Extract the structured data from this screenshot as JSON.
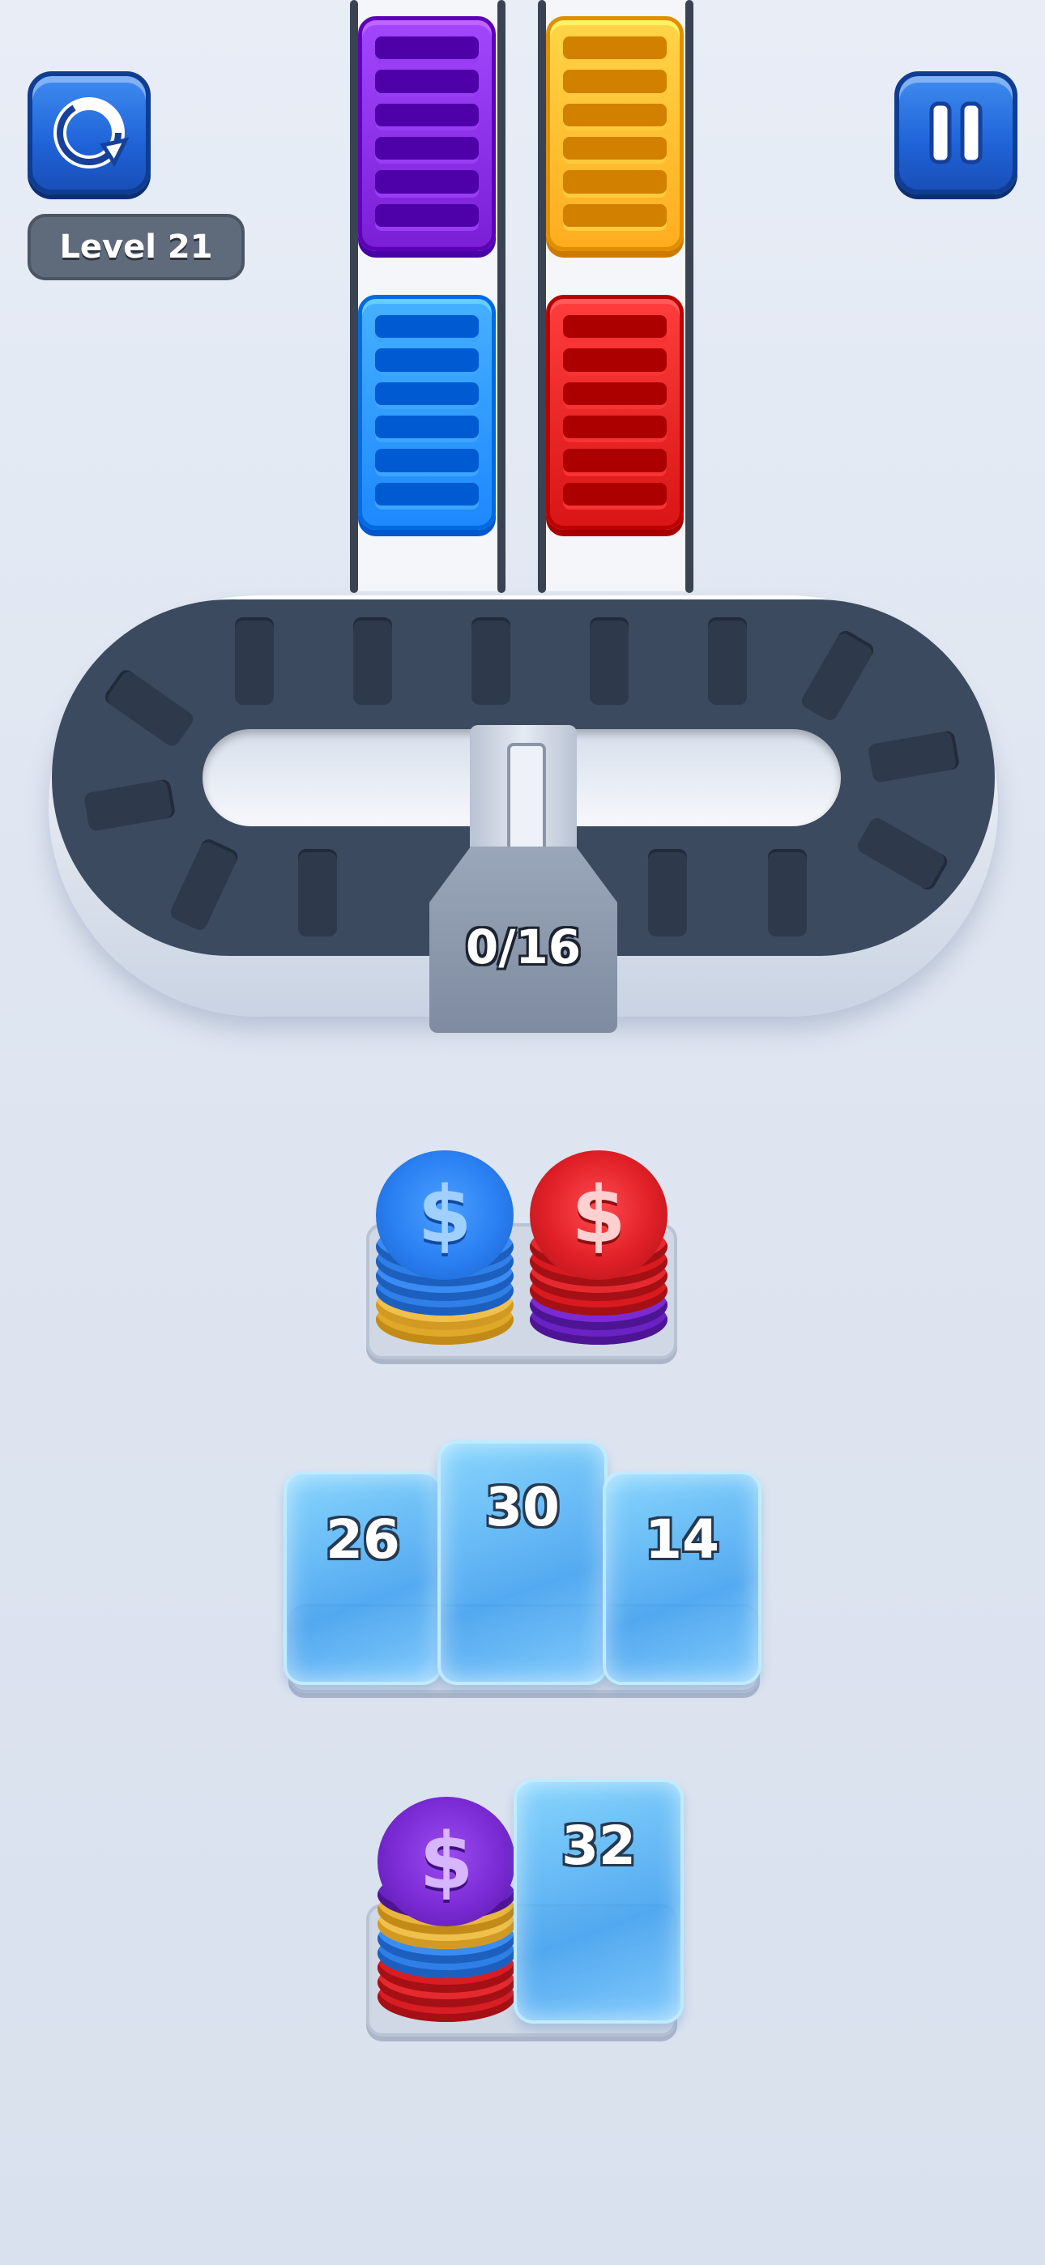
{
  "hud": {
    "restart_icon": "restart-icon",
    "pause_icon": "pause-icon",
    "level_label": "Level 21"
  },
  "crates": [
    {
      "color": "#7b1fd6"
    },
    {
      "color": "#ffad1f"
    },
    {
      "color": "#1e88ff"
    },
    {
      "color": "#d91515"
    }
  ],
  "collector": {
    "progress_text": "0/16",
    "collected": 0,
    "capacity": 16
  },
  "stacks": {
    "top_row": [
      {
        "top_color": "blue",
        "symbol": "$"
      },
      {
        "top_color": "red",
        "symbol": "$"
      }
    ],
    "frozen_row": [
      {
        "count": "26"
      },
      {
        "count": "30"
      },
      {
        "count": "14"
      }
    ],
    "bottom_row": [
      {
        "top_color": "purple",
        "symbol": "$"
      },
      {
        "count": "32"
      }
    ]
  },
  "colors": {
    "blue": "#2a7ff2",
    "red": "#e01f26",
    "purple": "#7a2bd4",
    "gold": "#f0b63a",
    "button": "#1f63d8"
  }
}
